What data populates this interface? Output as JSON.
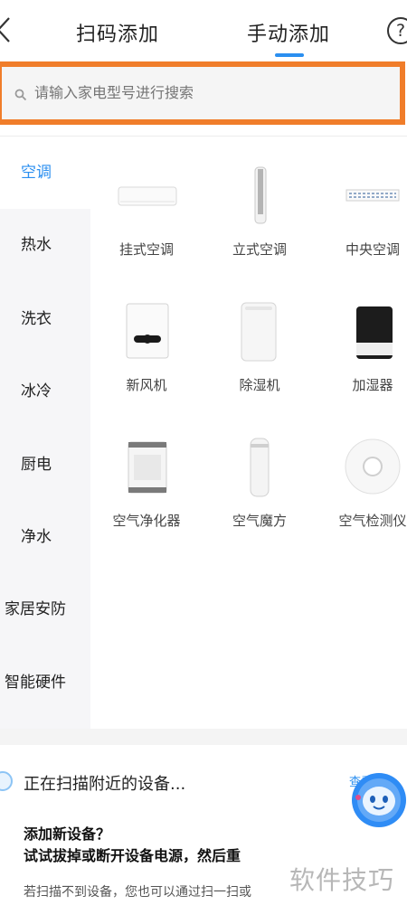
{
  "header": {
    "tabs": [
      {
        "label": "扫码添加",
        "active": false
      },
      {
        "label": "手动添加",
        "active": true
      }
    ],
    "help_label": "?"
  },
  "search": {
    "placeholder": "请输入家电型号进行搜索"
  },
  "categories": [
    {
      "label": "空调",
      "active": true
    },
    {
      "label": "热水"
    },
    {
      "label": "洗衣"
    },
    {
      "label": "冰冷"
    },
    {
      "label": "厨电"
    },
    {
      "label": "净水"
    },
    {
      "label": "家居安防"
    },
    {
      "label": "智能硬件"
    }
  ],
  "devices": [
    {
      "label": "挂式空调",
      "icon": "wall-ac-icon"
    },
    {
      "label": "立式空调",
      "icon": "floor-ac-icon"
    },
    {
      "label": "中央空调",
      "icon": "central-ac-icon"
    },
    {
      "label": "新风机",
      "icon": "fresh-air-icon"
    },
    {
      "label": "除湿机",
      "icon": "dehumidifier-icon"
    },
    {
      "label": "加湿器",
      "icon": "humidifier-icon"
    },
    {
      "label": "空气净化器",
      "icon": "air-purifier-icon"
    },
    {
      "label": "空气魔方",
      "icon": "air-cube-icon"
    },
    {
      "label": "空气检测仪",
      "icon": "air-detector-icon"
    }
  ],
  "scan_panel": {
    "status": "正在扫描附近的设备...",
    "more_link": "查看",
    "title": "添加新设备？",
    "subtitle": "试试拔掉或断开设备电源，然后重",
    "hint": "若扫描不到设备，您也可以通过扫一扫或"
  },
  "watermark": "软件技巧",
  "colors": {
    "accent": "#2b8ff0",
    "highlight_border": "#f07d2a",
    "sidebar_bg": "#f6f6f8"
  }
}
